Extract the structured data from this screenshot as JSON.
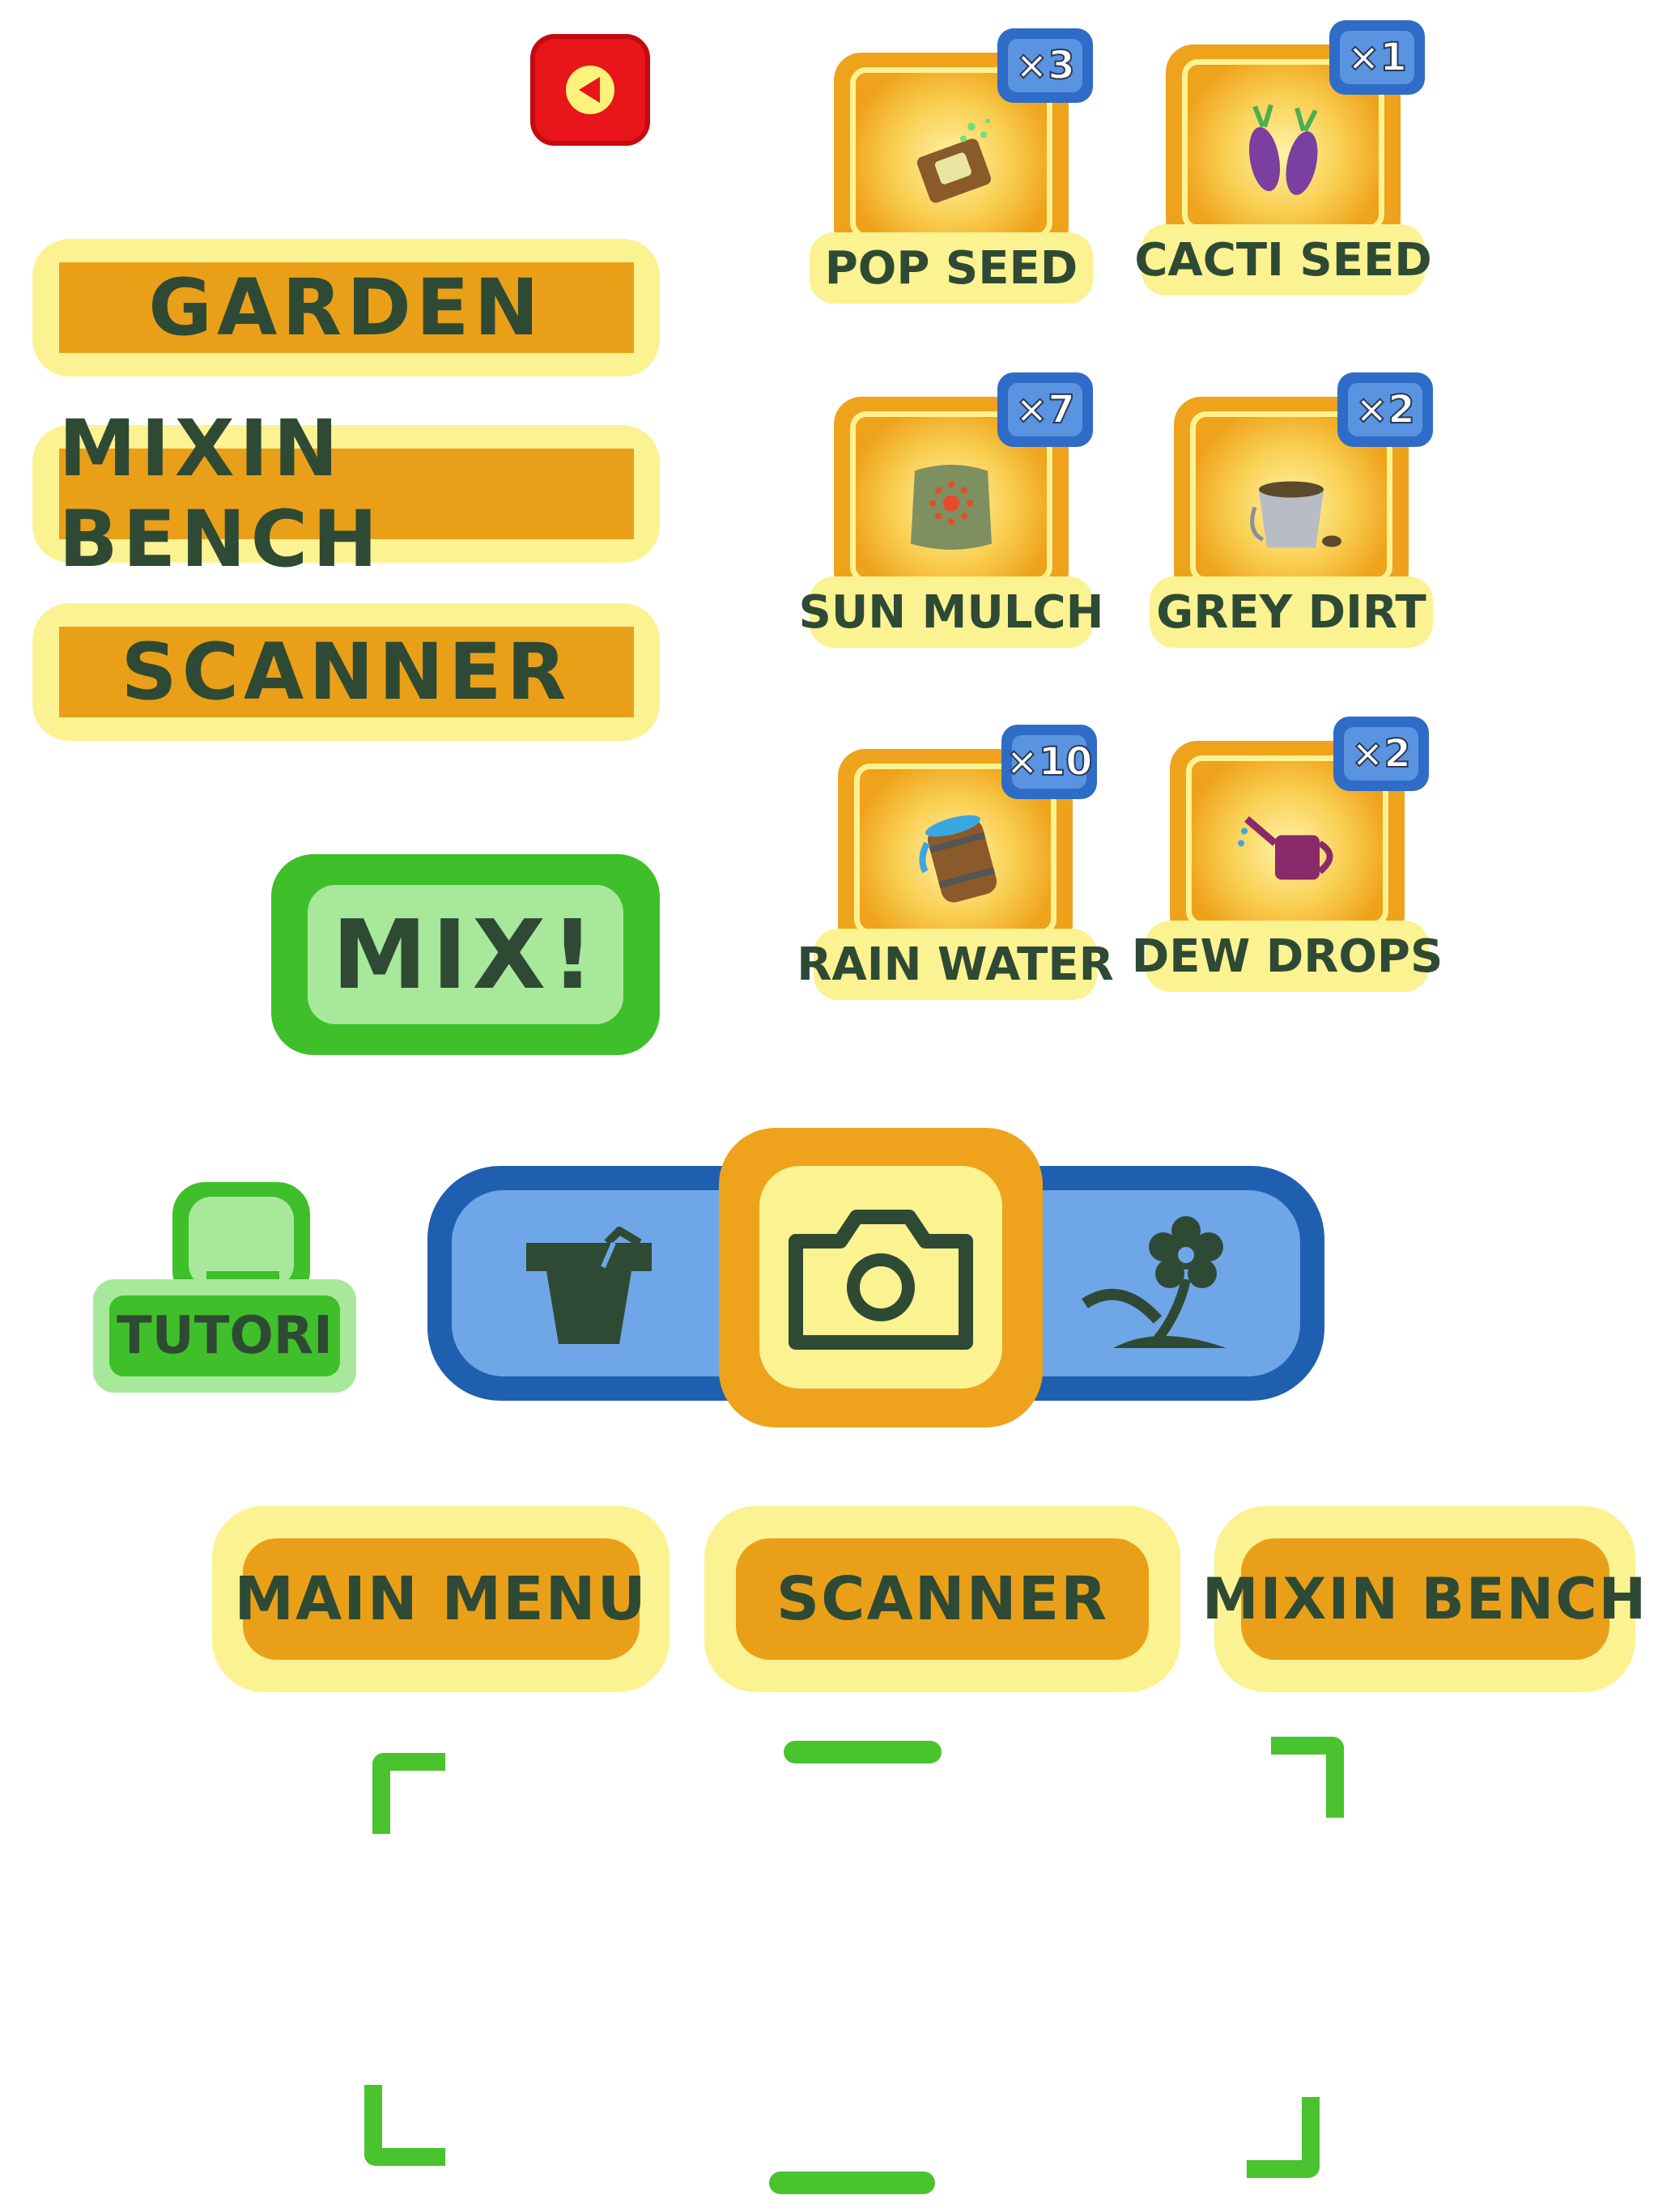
{
  "back_button": {
    "icon": "play-left-icon",
    "color": "#e8151a"
  },
  "menu": {
    "garden": "GARDEN",
    "mixin_bench": "MIXIN BENCH",
    "scanner": "SCANNER"
  },
  "mix_button": {
    "label": "MIX!"
  },
  "inventory": [
    {
      "name": "POP SEED",
      "count": "×3",
      "icon": "seed-packet-icon"
    },
    {
      "name": "CACTI SEED",
      "count": "×1",
      "icon": "cacti-seed-icon"
    },
    {
      "name": "SUN MULCH",
      "count": "×7",
      "icon": "mulch-bag-icon"
    },
    {
      "name": "GREY DIRT",
      "count": "×2",
      "icon": "dirt-bucket-icon"
    },
    {
      "name": "RAIN WATER",
      "count": "×10",
      "icon": "water-barrel-icon"
    },
    {
      "name": "DEW DROPS",
      "count": "×2",
      "icon": "watering-can-icon"
    }
  ],
  "tutorial": {
    "label": "TUTORI"
  },
  "navbar": {
    "items": [
      {
        "icon": "flower-pot-icon"
      },
      {
        "icon": "camera-icon",
        "selected": true
      },
      {
        "icon": "flower-icon"
      }
    ]
  },
  "page_buttons": {
    "main_menu": "MAIN MENU",
    "scanner": "SCANNER",
    "mixin_bench": "MIXIN BENCH"
  },
  "colors": {
    "orange": "#e9a018",
    "yellow": "#fbf291",
    "green": "#3fbf2a",
    "blue": "#1f5fb0",
    "text": "#2f4a34"
  }
}
